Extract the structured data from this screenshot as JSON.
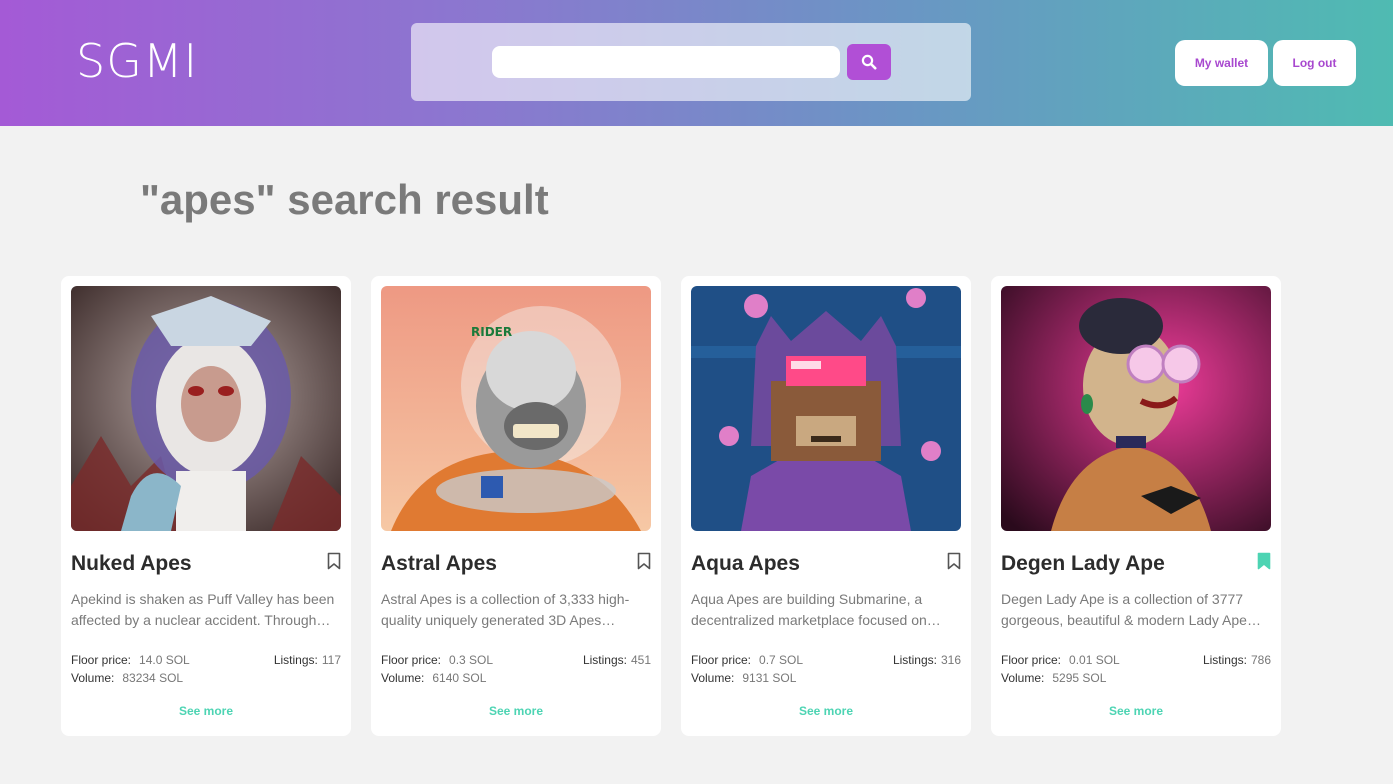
{
  "header": {
    "logo": "SGMI",
    "search": {
      "value": "",
      "placeholder": ""
    },
    "wallet_label": "My wallet",
    "logout_label": "Log out"
  },
  "results_title": "\"apes\" search result",
  "labels": {
    "floor_price": "Floor price:",
    "volume": "Volume:",
    "listings": "Listings:",
    "see_more": "See more"
  },
  "colors": {
    "accent_purple": "#b14fd6",
    "see_more_green": "#4dd4b3",
    "bookmark_active": "#4dd4b3"
  },
  "cards": [
    {
      "name": "Nuked Apes",
      "description": "Apekind is shaken as Puff Valley has been affected by a nuclear accident. Through…",
      "floor_price": "14.0 SOL",
      "volume": "83234 SOL",
      "listings": "117",
      "bookmarked": false,
      "icon": "bookmark-outline-icon"
    },
    {
      "name": "Astral Apes",
      "description": "Astral Apes is a collection of 3,333 high-quality uniquely generated 3D Apes…",
      "floor_price": "0.3 SOL",
      "volume": "6140 SOL",
      "listings": "451",
      "bookmarked": false,
      "icon": "bookmark-outline-icon"
    },
    {
      "name": "Aqua Apes",
      "description": "Aqua Apes are building Submarine, a decentralized marketplace focused on…",
      "floor_price": "0.7 SOL",
      "volume": "9131 SOL",
      "listings": "316",
      "bookmarked": false,
      "icon": "bookmark-outline-icon"
    },
    {
      "name": "Degen Lady Ape",
      "description": "Degen Lady Ape is a collection of 3777 gorgeous, beautiful & modern Lady Ape…",
      "floor_price": "0.01 SOL",
      "volume": "5295 SOL",
      "listings": "786",
      "bookmarked": true,
      "icon": "bookmark-filled-icon"
    }
  ]
}
